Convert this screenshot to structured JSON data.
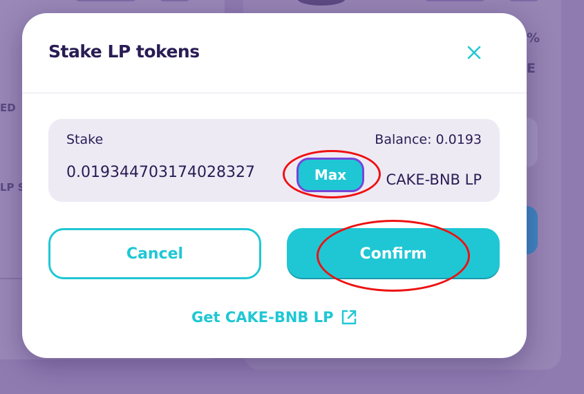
{
  "background": {
    "fragments": [
      "ED",
      "LP S",
      "%",
      "E"
    ]
  },
  "modal": {
    "title": "Stake LP tokens",
    "close_icon": "close-icon"
  },
  "stake": {
    "label": "Stake",
    "balance": "Balance: 0.0193",
    "amount": "0.019344703174028327",
    "max_label": "Max",
    "token_symbol": "CAKE-BNB LP"
  },
  "actions": {
    "cancel_label": "Cancel",
    "confirm_label": "Confirm"
  },
  "footer": {
    "get_link_label": "Get CAKE-BNB LP",
    "link_icon": "external-link-icon"
  },
  "colors": {
    "primary": "#1fc7d4",
    "secondary": "#7645d9",
    "text": "#2a1c54",
    "input_bg": "#eeeaf4",
    "annotation": "#ee1111"
  }
}
